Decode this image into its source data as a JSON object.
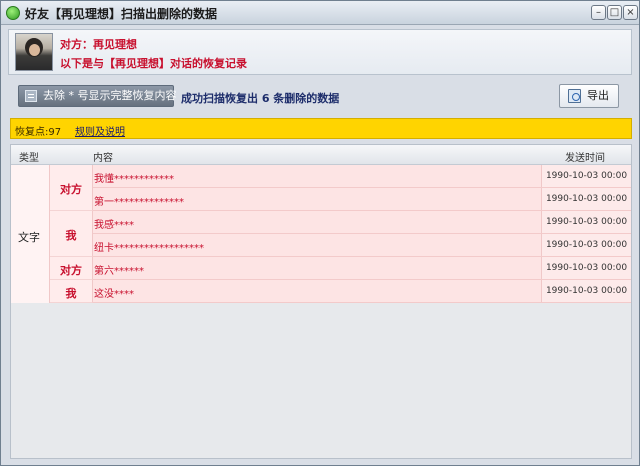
{
  "window": {
    "title": "好友【再见理想】扫描出删除的数据",
    "minimize_glyph": "–",
    "maximize_glyph": "□",
    "close_glyph": "×"
  },
  "header": {
    "contact_line": "对方：再见理想",
    "description": "以下是与【再见理想】对话的恢复记录"
  },
  "toolbar": {
    "reveal_button": "去除 * 号显示完整恢复内容",
    "status": "成功扫描恢复出 6 条删除的数据",
    "export_button": "导出"
  },
  "restore": {
    "label": "恢复点:97",
    "rules_link": "规则及说明"
  },
  "table": {
    "columns": {
      "type": "类型",
      "content": "内容",
      "time": "发送时间"
    },
    "type_value": "文字",
    "senders": [
      "对方",
      "我",
      "对方",
      "我"
    ],
    "rows": [
      {
        "content": "我懂************",
        "time": "1990-10-03 00:00"
      },
      {
        "content": "第一**************",
        "time": "1990-10-03 00:00"
      },
      {
        "content": "我感****",
        "time": "1990-10-03 00:00"
      },
      {
        "content": "纽卡******************",
        "time": "1990-10-03 00:00"
      },
      {
        "content": "第六******",
        "time": "1990-10-03 00:00"
      },
      {
        "content": "这没****",
        "time": "1990-10-03 00:00"
      }
    ]
  },
  "icons": {
    "app": "chat-app-icon",
    "reveal": "list-icon",
    "export": "export-icon"
  },
  "colors": {
    "accent_red": "#c8102e",
    "restore_bar": "#ffd400",
    "row_background": "#fde4e4"
  }
}
